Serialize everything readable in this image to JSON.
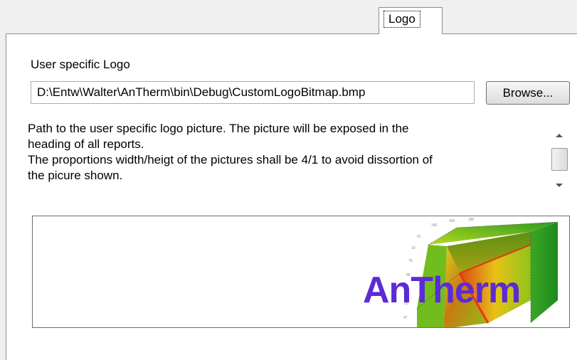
{
  "tabs": [
    {
      "label": "Logo"
    }
  ],
  "logo_section": {
    "label": "User specific Logo",
    "path_value": "D:\\Entw\\Walter\\AnTherm\\bin\\Debug\\CustomLogoBitmap.bmp",
    "browse_label": "Browse...",
    "description": "Path to the user specific logo picture. The picture will be exposed in the\nheading of all reports.\nThe proportions width/heigt of the pictures shall be 4/1 to avoid dissortion of\nthe picure shown."
  },
  "preview": {
    "logo_text": "AnTherm",
    "logo_text_color": "#5b2bd6"
  }
}
